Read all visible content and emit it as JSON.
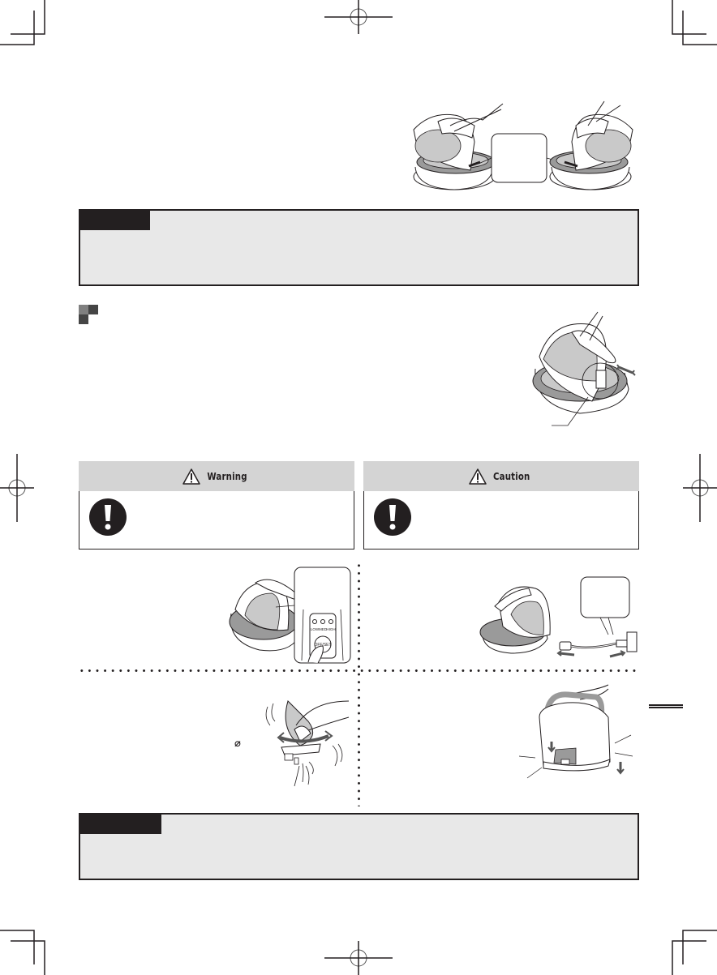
{
  "page": {
    "type": "appliance-manual-page",
    "background": "#ffffff",
    "ink_color": "#231f20"
  },
  "top_section": {
    "body_text": "",
    "illustration": {
      "name": "iron-placing-on-base",
      "callout_text": ""
    }
  },
  "note_box_1": {
    "tab_label": "",
    "body_text": "",
    "colors": {
      "tab": "#231f20",
      "fill": "#e8e8e8"
    }
  },
  "section": {
    "marker_icon": "square-bullet-icon",
    "heading": "",
    "body_text": "",
    "illustration": {
      "name": "iron-slide-on-base",
      "leader_label": ""
    }
  },
  "alerts": [
    {
      "kind": "warning",
      "title": "Warning",
      "icon": "warning-triangle-icon",
      "body_icon": "mandatory-exclamation-icon",
      "body_text": "",
      "header_color": "#d4d4d4"
    },
    {
      "kind": "caution",
      "title": "Caution",
      "icon": "warning-triangle-icon",
      "body_icon": "mandatory-exclamation-icon",
      "body_text": "",
      "header_color": "#d4d4d4"
    }
  ],
  "steps": [
    {
      "id": 1,
      "text": "",
      "illustration": "press-off-button",
      "panel_labels": [
        "LOW",
        "MED",
        "HIGH"
      ],
      "button_label": "OFF/SET"
    },
    {
      "id": 2,
      "text": "",
      "illustration": "unplug-power-cord",
      "callout_text": ""
    },
    {
      "id": 3,
      "text": "",
      "symbol": "⌀",
      "illustration": "shake-water-from-iron"
    },
    {
      "id": 4,
      "text": "",
      "illustration": "carry-storage-case"
    }
  ],
  "note_box_2": {
    "tab_label": "",
    "body_text": ""
  }
}
